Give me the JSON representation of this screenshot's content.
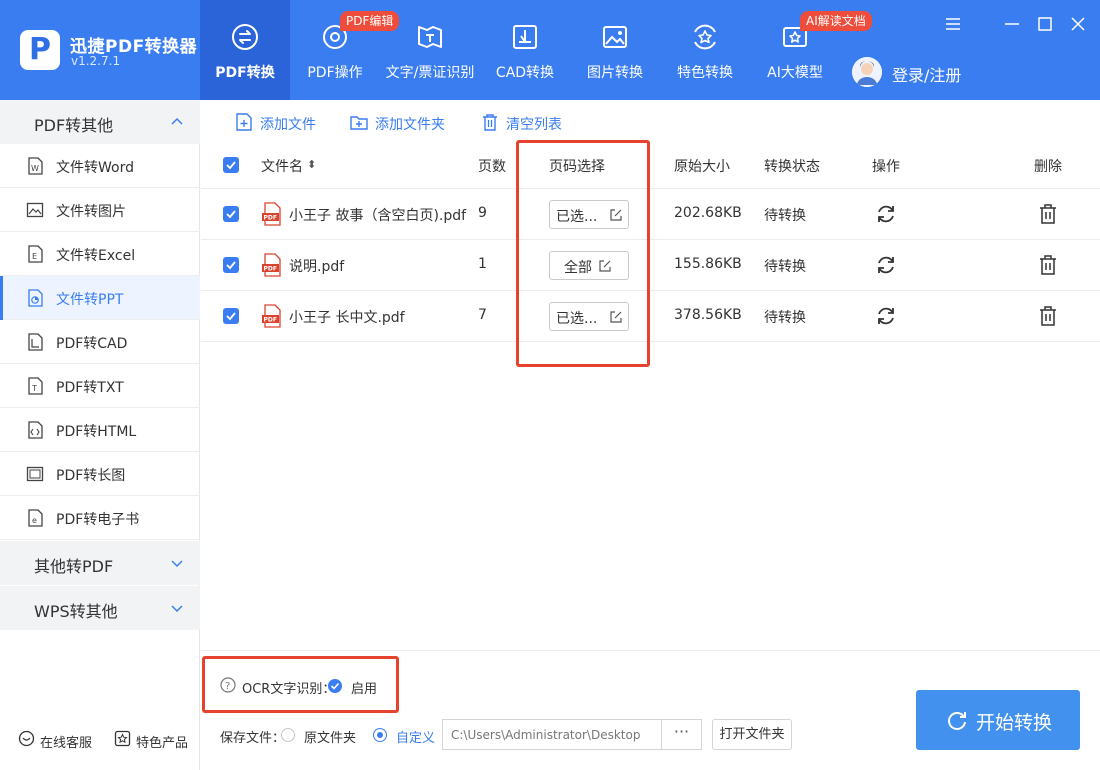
{
  "app": {
    "name": "迅捷PDF转换器",
    "version": "v1.2.7.1"
  },
  "nav": [
    {
      "label": "PDF转换",
      "active": true
    },
    {
      "label": "PDF操作",
      "badge": "PDF编辑"
    },
    {
      "label": "文字/票证识别"
    },
    {
      "label": "CAD转换"
    },
    {
      "label": "图片转换"
    },
    {
      "label": "特色转换"
    },
    {
      "label": "AI大模型",
      "badge": "AI解读文档"
    }
  ],
  "user": {
    "login_label": "登录/注册"
  },
  "sidebar": {
    "groups": [
      {
        "label": "PDF转其他",
        "expanded": true
      },
      {
        "label": "其他转PDF",
        "expanded": false
      },
      {
        "label": "WPS转其他",
        "expanded": false
      }
    ],
    "items": [
      {
        "label": "文件转Word"
      },
      {
        "label": "文件转图片"
      },
      {
        "label": "文件转Excel"
      },
      {
        "label": "文件转PPT",
        "active": true
      },
      {
        "label": "PDF转CAD"
      },
      {
        "label": "PDF转TXT"
      },
      {
        "label": "PDF转HTML"
      },
      {
        "label": "PDF转长图"
      },
      {
        "label": "PDF转电子书"
      }
    ],
    "bottom": {
      "service": "在线客服",
      "products": "特色产品"
    }
  },
  "toolbar": {
    "add_file": "添加文件",
    "add_folder": "添加文件夹",
    "clear_list": "清空列表"
  },
  "table": {
    "headers": {
      "name": "文件名",
      "sort_mark": "⬍",
      "pages": "页数",
      "page_select": "页码选择",
      "size": "原始大小",
      "status": "转换状态",
      "action": "操作",
      "delete": "删除"
    },
    "rows": [
      {
        "name": "小王子 故事（含空白页).pdf",
        "pages": "9",
        "page_select": "已选...",
        "size": "202.68KB",
        "status": "待转换",
        "checked": true
      },
      {
        "name": "说明.pdf",
        "pages": "1",
        "page_select": "全部",
        "size": "155.86KB",
        "status": "待转换",
        "checked": true
      },
      {
        "name": "小王子 长中文.pdf",
        "pages": "7",
        "page_select": "已选...",
        "size": "378.56KB",
        "status": "待转换",
        "checked": true
      }
    ]
  },
  "ocr": {
    "label": "OCR文字识别：",
    "value": "启用",
    "enabled": true
  },
  "save": {
    "label": "保存文件：",
    "option_original": "原文件夹",
    "option_custom": "自定义",
    "selected": "custom",
    "path": "C:\\Users\\Administrator\\Desktop",
    "browse_label": "···",
    "open_folder": "打开文件夹"
  },
  "start_button": "开始转换",
  "colors": {
    "primary": "#3a7df0",
    "highlight": "#e5432d",
    "badge": "#ee4d3b"
  }
}
